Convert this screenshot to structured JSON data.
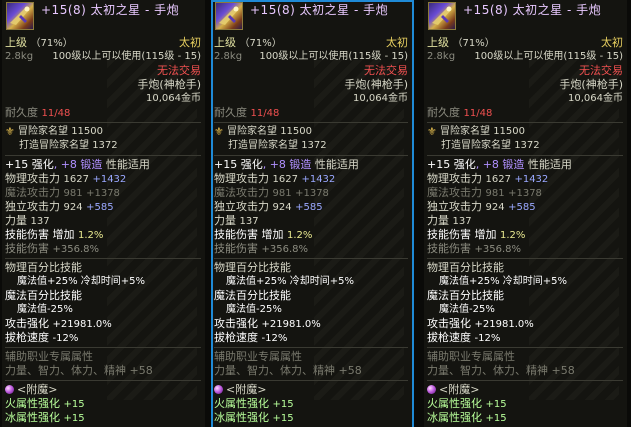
{
  "tooltips": [
    {
      "title": "+15(8) 太初之星 - 手炮",
      "grade": "上级",
      "grade_pct": "（71%）",
      "rarity": "太初",
      "weight": "2.8kg",
      "level_req": "100级以上可以使用(115级 - 15)",
      "trade": "无法交易",
      "type": "手炮(神枪手)",
      "price": "10,064金币",
      "durability_label": "耐久度",
      "durability_value": "11/48",
      "fame_label": "冒险家名望",
      "fame_value": "11500",
      "forge_fame_label": "打造冒险家名望",
      "forge_fame_value": "1372",
      "reinforce_a": "+15 强化",
      "reinforce_b": ", +8 锻造",
      "reinforce_c": " 性能适用",
      "phys_atk_label": "物理攻击力",
      "phys_atk_base": "1627",
      "phys_atk_bonus": "+1432",
      "mag_atk_label": "魔法攻击力",
      "mag_atk_base": "981",
      "mag_atk_bonus": "+1378",
      "ind_atk_label": "独立攻击力",
      "ind_atk_base": "924",
      "ind_atk_bonus": "+585",
      "str_label": "力量",
      "str_value": "137",
      "skill_dmg_label": "技能伤害",
      "skill_dmg_inc": "增加",
      "skill_dmg_pct": "1.2%",
      "skill_dmg_total_label": "技能伤害",
      "skill_dmg_total": "+356.8%",
      "pct_header": "物理百分比技能",
      "pct_line1_a": "魔法值+25%",
      "pct_line1_b": "冷却时间+5%",
      "pct_header2": "魔法百分比技能",
      "pct_line2": "魔法值-25%",
      "atk_strength_label": "攻击强化",
      "atk_strength_value": "+21981.0%",
      "draw_speed_label": "拔枪速度",
      "draw_speed_value": "-12%",
      "support_header": "辅助职业专属属性",
      "support_line": "力量、智力、体力、精神 +58",
      "enchant_label": "<附魔>",
      "fire_label": "火属性强化",
      "fire_value": "+15",
      "ice_label": "冰属性强化",
      "ice_value": "+15"
    },
    {
      "title": "+15(8) 太初之星 - 手炮",
      "grade": "上级",
      "grade_pct": "（71%）",
      "rarity": "太初",
      "weight": "2.8kg",
      "level_req": "100级以上可以使用(115级 - 15)",
      "trade": "无法交易",
      "type": "手炮(神枪手)",
      "price": "10,064金币",
      "durability_label": "耐久度",
      "durability_value": "11/48",
      "fame_label": "冒险家名望",
      "fame_value": "11500",
      "forge_fame_label": "打造冒险家名望",
      "forge_fame_value": "1372",
      "reinforce_a": "+15 强化",
      "reinforce_b": ", +8 锻造",
      "reinforce_c": " 性能适用",
      "phys_atk_label": "物理攻击力",
      "phys_atk_base": "1627",
      "phys_atk_bonus": "+1432",
      "mag_atk_label": "魔法攻击力",
      "mag_atk_base": "981",
      "mag_atk_bonus": "+1378",
      "ind_atk_label": "独立攻击力",
      "ind_atk_base": "924",
      "ind_atk_bonus": "+585",
      "str_label": "力量",
      "str_value": "137",
      "skill_dmg_label": "技能伤害",
      "skill_dmg_inc": "增加",
      "skill_dmg_pct": "1.2%",
      "skill_dmg_total_label": "技能伤害",
      "skill_dmg_total": "+356.8%",
      "pct_header": "物理百分比技能",
      "pct_line1_a": "魔法值+25%",
      "pct_line1_b": "冷却时间+5%",
      "pct_header2": "魔法百分比技能",
      "pct_line2": "魔法值-25%",
      "atk_strength_label": "攻击强化",
      "atk_strength_value": "+21981.0%",
      "draw_speed_label": "拔枪速度",
      "draw_speed_value": "-12%",
      "support_header": "辅助职业专属属性",
      "support_line": "力量、智力、体力、精神 +58",
      "enchant_label": "<附魔>",
      "fire_label": "火属性强化",
      "fire_value": "+15",
      "ice_label": "冰属性强化",
      "ice_value": "+15"
    },
    {
      "title": "+15(8) 太初之星 - 手炮",
      "grade": "上级",
      "grade_pct": "（71%）",
      "rarity": "太初",
      "weight": "2.8kg",
      "level_req": "100级以上可以使用(115级 - 15)",
      "trade": "无法交易",
      "type": "手炮(神枪手)",
      "price": "10,064金币",
      "durability_label": "耐久度",
      "durability_value": "11/48",
      "fame_label": "冒险家名望",
      "fame_value": "11500",
      "forge_fame_label": "打造冒险家名望",
      "forge_fame_value": "1372",
      "reinforce_a": "+15 强化",
      "reinforce_b": ", +8 锻造",
      "reinforce_c": " 性能适用",
      "phys_atk_label": "物理攻击力",
      "phys_atk_base": "1627",
      "phys_atk_bonus": "+1432",
      "mag_atk_label": "魔法攻击力",
      "mag_atk_base": "981",
      "mag_atk_bonus": "+1378",
      "ind_atk_label": "独立攻击力",
      "ind_atk_base": "924",
      "ind_atk_bonus": "+585",
      "str_label": "力量",
      "str_value": "137",
      "skill_dmg_label": "技能伤害",
      "skill_dmg_inc": "增加",
      "skill_dmg_pct": "1.2%",
      "skill_dmg_total_label": "技能伤害",
      "skill_dmg_total": "+356.8%",
      "pct_header": "物理百分比技能",
      "pct_line1_a": "魔法值+25%",
      "pct_line1_b": "冷却时间+5%",
      "pct_header2": "魔法百分比技能",
      "pct_line2": "魔法值-25%",
      "atk_strength_label": "攻击强化",
      "atk_strength_value": "+21981.0%",
      "draw_speed_label": "拔枪速度",
      "draw_speed_value": "-12%",
      "support_header": "辅助职业专属属性",
      "support_line": "力量、智力、体力、精神 +58",
      "enchant_label": "<附魔>",
      "fire_label": "火属性强化",
      "fire_value": "+15",
      "ice_label": "冰属性强化",
      "ice_value": "+15"
    }
  ],
  "colors": {
    "title": "#e8c8ff",
    "rarity": "#e8d060",
    "trade_red": "#f05050",
    "forge_purple": "#b090ff",
    "bonus_blue": "#9aa8ff",
    "element_green": "#b8ff9a",
    "selected_border": "#1f8ad6"
  },
  "icons": {
    "item": "hand-cannon-icon",
    "fame": "crest-icon",
    "enchant": "orb-icon"
  }
}
